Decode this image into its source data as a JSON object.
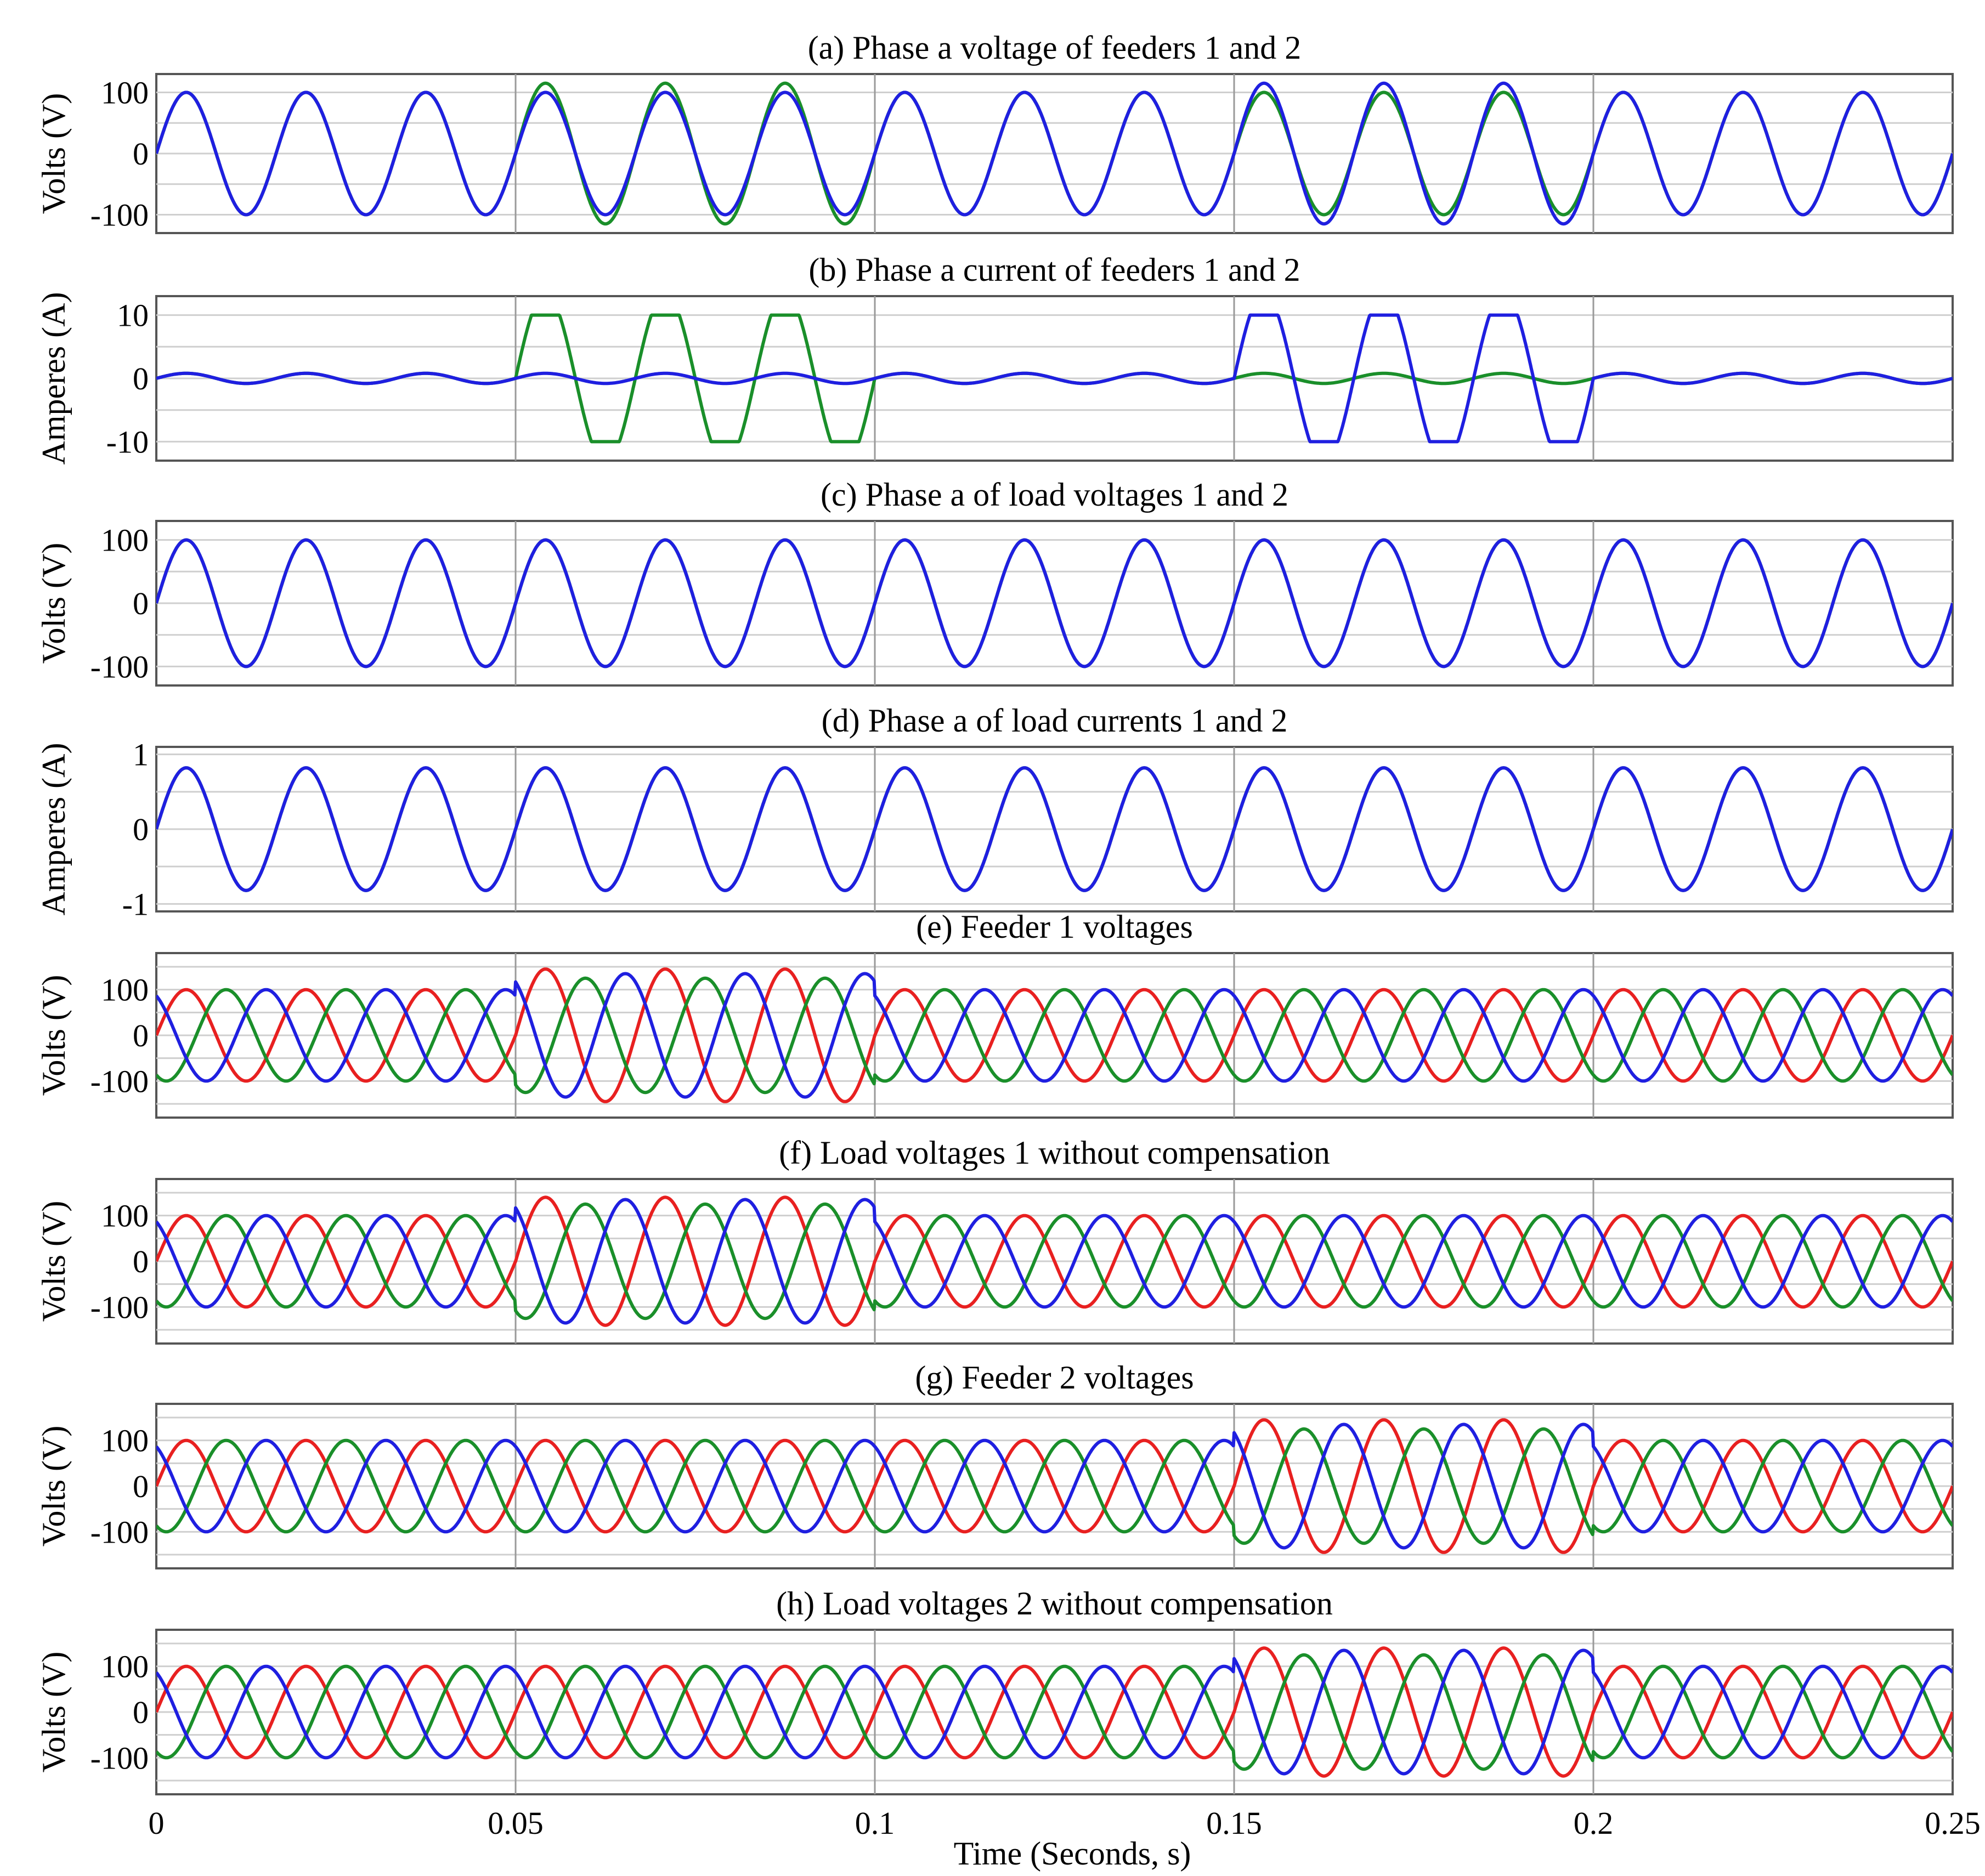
{
  "chart_data": {
    "type": "line",
    "xlabel": "Time (Seconds, s)",
    "xlim": [
      0,
      0.25
    ],
    "xticks": [
      0,
      0.05,
      0.1,
      0.15,
      0.2,
      0.25
    ],
    "xtick_labels": [
      "0",
      "0.05",
      "0.1",
      "0.15",
      "0.2",
      "0.25"
    ],
    "colors": {
      "green": "#1a8f2a",
      "blue": "#1f1fe0",
      "red": "#e82020"
    },
    "frequency_hz": 60,
    "panels": [
      {
        "id": "a",
        "title": "(a) Phase a voltage of feeders 1 and 2",
        "ylabel": "Volts (V)",
        "ylim": [
          -130,
          130
        ],
        "yticks": [
          100,
          0,
          -100
        ],
        "ytick_labels": [
          "100",
          "0",
          "-100"
        ],
        "grid": true,
        "series": [
          {
            "color": "green",
            "phase_deg": 0,
            "segments": [
              {
                "t0": 0,
                "t1": 0.05,
                "amplitude": 100
              },
              {
                "t0": 0.05,
                "t1": 0.1,
                "amplitude": 115
              },
              {
                "t0": 0.1,
                "t1": 0.15,
                "amplitude": 100
              },
              {
                "t0": 0.15,
                "t1": 0.2,
                "amplitude": 100
              },
              {
                "t0": 0.2,
                "t1": 0.25,
                "amplitude": 100
              }
            ]
          },
          {
            "color": "blue",
            "phase_deg": 0,
            "segments": [
              {
                "t0": 0,
                "t1": 0.05,
                "amplitude": 100
              },
              {
                "t0": 0.05,
                "t1": 0.1,
                "amplitude": 100
              },
              {
                "t0": 0.1,
                "t1": 0.15,
                "amplitude": 100
              },
              {
                "t0": 0.15,
                "t1": 0.2,
                "amplitude": 115
              },
              {
                "t0": 0.2,
                "t1": 0.25,
                "amplitude": 100
              }
            ]
          }
        ]
      },
      {
        "id": "b",
        "title": "(b) Phase a current of feeders 1 and 2",
        "ylabel": "Amperes (A)",
        "ylim": [
          -13,
          13
        ],
        "yticks": [
          10,
          0,
          -10
        ],
        "ytick_labels": [
          "10",
          "0",
          "-10"
        ],
        "grid": true,
        "series": [
          {
            "color": "green",
            "phase_deg": 0,
            "segments": [
              {
                "t0": 0,
                "t1": 0.05,
                "amplitude": 0.8
              },
              {
                "t0": 0.05,
                "t1": 0.1,
                "amplitude": 10,
                "clipped": true
              },
              {
                "t0": 0.1,
                "t1": 0.15,
                "amplitude": 0.8
              },
              {
                "t0": 0.15,
                "t1": 0.2,
                "amplitude": 0.8
              },
              {
                "t0": 0.2,
                "t1": 0.25,
                "amplitude": 0.8
              }
            ]
          },
          {
            "color": "blue",
            "phase_deg": 0,
            "segments": [
              {
                "t0": 0,
                "t1": 0.05,
                "amplitude": 0.8
              },
              {
                "t0": 0.05,
                "t1": 0.1,
                "amplitude": 0.8
              },
              {
                "t0": 0.1,
                "t1": 0.15,
                "amplitude": 0.8
              },
              {
                "t0": 0.15,
                "t1": 0.2,
                "amplitude": 10,
                "clipped": true
              },
              {
                "t0": 0.2,
                "t1": 0.25,
                "amplitude": 0.8
              }
            ]
          }
        ]
      },
      {
        "id": "c",
        "title": "(c) Phase a of load voltages 1 and 2",
        "ylabel": "Volts (V)",
        "ylim": [
          -130,
          130
        ],
        "yticks": [
          100,
          0,
          -100
        ],
        "ytick_labels": [
          "100",
          "0",
          "-100"
        ],
        "grid": true,
        "series": [
          {
            "color": "green",
            "phase_deg": 0,
            "segments": [
              {
                "t0": 0,
                "t1": 0.25,
                "amplitude": 100
              }
            ]
          },
          {
            "color": "blue",
            "phase_deg": 0,
            "segments": [
              {
                "t0": 0,
                "t1": 0.25,
                "amplitude": 100
              }
            ]
          }
        ]
      },
      {
        "id": "d",
        "title": "(d) Phase a of load currents 1 and 2",
        "ylabel": "Amperes (A)",
        "ylim": [
          -1.1,
          1.1
        ],
        "yticks": [
          1,
          0,
          -1
        ],
        "ytick_labels": [
          "1",
          "0",
          "-1"
        ],
        "grid": true,
        "series": [
          {
            "color": "green",
            "phase_deg": 0,
            "segments": [
              {
                "t0": 0,
                "t1": 0.25,
                "amplitude": 0.82
              }
            ]
          },
          {
            "color": "blue",
            "phase_deg": 0,
            "segments": [
              {
                "t0": 0,
                "t1": 0.25,
                "amplitude": 0.82
              }
            ]
          }
        ]
      },
      {
        "id": "e",
        "title": "(e) Feeder 1 voltages",
        "ylabel": "Volts (V)",
        "ylim": [
          -180,
          180
        ],
        "yticks": [
          100,
          0,
          -100
        ],
        "ytick_labels": [
          "100",
          "0",
          "-100"
        ],
        "grid": true,
        "series": [
          {
            "color": "red",
            "phase_deg": 0,
            "segments": [
              {
                "t0": 0,
                "t1": 0.05,
                "amplitude": 100
              },
              {
                "t0": 0.05,
                "t1": 0.1,
                "amplitude": 145
              },
              {
                "t0": 0.1,
                "t1": 0.25,
                "amplitude": 100
              }
            ]
          },
          {
            "color": "green",
            "phase_deg": -120,
            "segments": [
              {
                "t0": 0,
                "t1": 0.05,
                "amplitude": 100
              },
              {
                "t0": 0.05,
                "t1": 0.1,
                "amplitude": 125
              },
              {
                "t0": 0.1,
                "t1": 0.25,
                "amplitude": 100
              }
            ]
          },
          {
            "color": "blue",
            "phase_deg": 120,
            "segments": [
              {
                "t0": 0,
                "t1": 0.05,
                "amplitude": 100
              },
              {
                "t0": 0.05,
                "t1": 0.1,
                "amplitude": 135
              },
              {
                "t0": 0.1,
                "t1": 0.25,
                "amplitude": 100
              }
            ]
          }
        ]
      },
      {
        "id": "f",
        "title": "(f) Load voltages 1 without compensation",
        "ylabel": "Volts (V)",
        "ylim": [
          -180,
          180
        ],
        "yticks": [
          100,
          0,
          -100
        ],
        "ytick_labels": [
          "100",
          "0",
          "-100"
        ],
        "grid": true,
        "series": [
          {
            "color": "red",
            "phase_deg": 0,
            "segments": [
              {
                "t0": 0,
                "t1": 0.05,
                "amplitude": 100
              },
              {
                "t0": 0.05,
                "t1": 0.1,
                "amplitude": 140
              },
              {
                "t0": 0.1,
                "t1": 0.25,
                "amplitude": 100
              }
            ]
          },
          {
            "color": "green",
            "phase_deg": -120,
            "segments": [
              {
                "t0": 0,
                "t1": 0.05,
                "amplitude": 100
              },
              {
                "t0": 0.05,
                "t1": 0.1,
                "amplitude": 125
              },
              {
                "t0": 0.1,
                "t1": 0.25,
                "amplitude": 100
              }
            ]
          },
          {
            "color": "blue",
            "phase_deg": 120,
            "segments": [
              {
                "t0": 0,
                "t1": 0.05,
                "amplitude": 100
              },
              {
                "t0": 0.05,
                "t1": 0.1,
                "amplitude": 135
              },
              {
                "t0": 0.1,
                "t1": 0.25,
                "amplitude": 100
              }
            ]
          }
        ]
      },
      {
        "id": "g",
        "title": "(g) Feeder 2 voltages",
        "ylabel": "Volts (V)",
        "ylim": [
          -180,
          180
        ],
        "yticks": [
          100,
          0,
          -100
        ],
        "ytick_labels": [
          "100",
          "0",
          "-100"
        ],
        "grid": true,
        "series": [
          {
            "color": "red",
            "phase_deg": 0,
            "segments": [
              {
                "t0": 0,
                "t1": 0.15,
                "amplitude": 100
              },
              {
                "t0": 0.15,
                "t1": 0.2,
                "amplitude": 145
              },
              {
                "t0": 0.2,
                "t1": 0.25,
                "amplitude": 100
              }
            ]
          },
          {
            "color": "green",
            "phase_deg": -120,
            "segments": [
              {
                "t0": 0,
                "t1": 0.15,
                "amplitude": 100
              },
              {
                "t0": 0.15,
                "t1": 0.2,
                "amplitude": 125
              },
              {
                "t0": 0.2,
                "t1": 0.25,
                "amplitude": 100
              }
            ]
          },
          {
            "color": "blue",
            "phase_deg": 120,
            "segments": [
              {
                "t0": 0,
                "t1": 0.15,
                "amplitude": 100
              },
              {
                "t0": 0.15,
                "t1": 0.2,
                "amplitude": 135
              },
              {
                "t0": 0.2,
                "t1": 0.25,
                "amplitude": 100
              }
            ]
          }
        ]
      },
      {
        "id": "h",
        "title": "(h) Load voltages 2 without compensation",
        "ylabel": "Volts (V)",
        "ylim": [
          -180,
          180
        ],
        "yticks": [
          100,
          0,
          -100
        ],
        "ytick_labels": [
          "100",
          "0",
          "-100"
        ],
        "grid": true,
        "series": [
          {
            "color": "red",
            "phase_deg": 0,
            "segments": [
              {
                "t0": 0,
                "t1": 0.15,
                "amplitude": 100
              },
              {
                "t0": 0.15,
                "t1": 0.2,
                "amplitude": 140
              },
              {
                "t0": 0.2,
                "t1": 0.25,
                "amplitude": 100
              }
            ]
          },
          {
            "color": "green",
            "phase_deg": -120,
            "segments": [
              {
                "t0": 0,
                "t1": 0.15,
                "amplitude": 100
              },
              {
                "t0": 0.15,
                "t1": 0.2,
                "amplitude": 125
              },
              {
                "t0": 0.2,
                "t1": 0.25,
                "amplitude": 100
              }
            ]
          },
          {
            "color": "blue",
            "phase_deg": 120,
            "segments": [
              {
                "t0": 0,
                "t1": 0.15,
                "amplitude": 100
              },
              {
                "t0": 0.15,
                "t1": 0.2,
                "amplitude": 135
              },
              {
                "t0": 0.2,
                "t1": 0.25,
                "amplitude": 100
              }
            ]
          }
        ]
      }
    ]
  }
}
